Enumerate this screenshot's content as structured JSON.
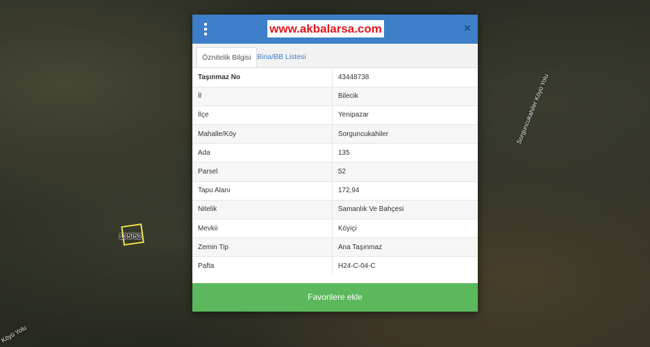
{
  "map": {
    "parcel_label": "135/52",
    "road_label_right": "Sorguncukahiler Köyü Yolu",
    "road_label_bottom": "Köyü Yolu"
  },
  "modal": {
    "brand": "www.akbalarsa.com",
    "close_symbol": "×",
    "tabs": [
      {
        "label": "Öznitelik Bilgisi",
        "active": true
      },
      {
        "label": "Bina/BB Listesi",
        "active": false
      }
    ],
    "rows": [
      {
        "key": "Taşınmaz No",
        "value": "43448738"
      },
      {
        "key": "İl",
        "value": "Bilecik"
      },
      {
        "key": "İlçe",
        "value": "Yenipazar"
      },
      {
        "key": "Mahalle/Köy",
        "value": "Sorguncukahiler"
      },
      {
        "key": "Ada",
        "value": "135"
      },
      {
        "key": "Parsel",
        "value": "52"
      },
      {
        "key": "Tapu Alanı",
        "value": "172,94"
      },
      {
        "key": "Nitelik",
        "value": "Samanlık Ve Bahçesi"
      },
      {
        "key": "Mevkii",
        "value": "Köyiçi"
      },
      {
        "key": "Zemin Tip",
        "value": "Ana Taşınmaz"
      },
      {
        "key": "Pafta",
        "value": "H24-C-04-C"
      }
    ],
    "favorite_button": "Favorilere ekle"
  },
  "colors": {
    "header": "#3d7fc8",
    "brand_text": "#e0161d",
    "button": "#5cb85c"
  }
}
